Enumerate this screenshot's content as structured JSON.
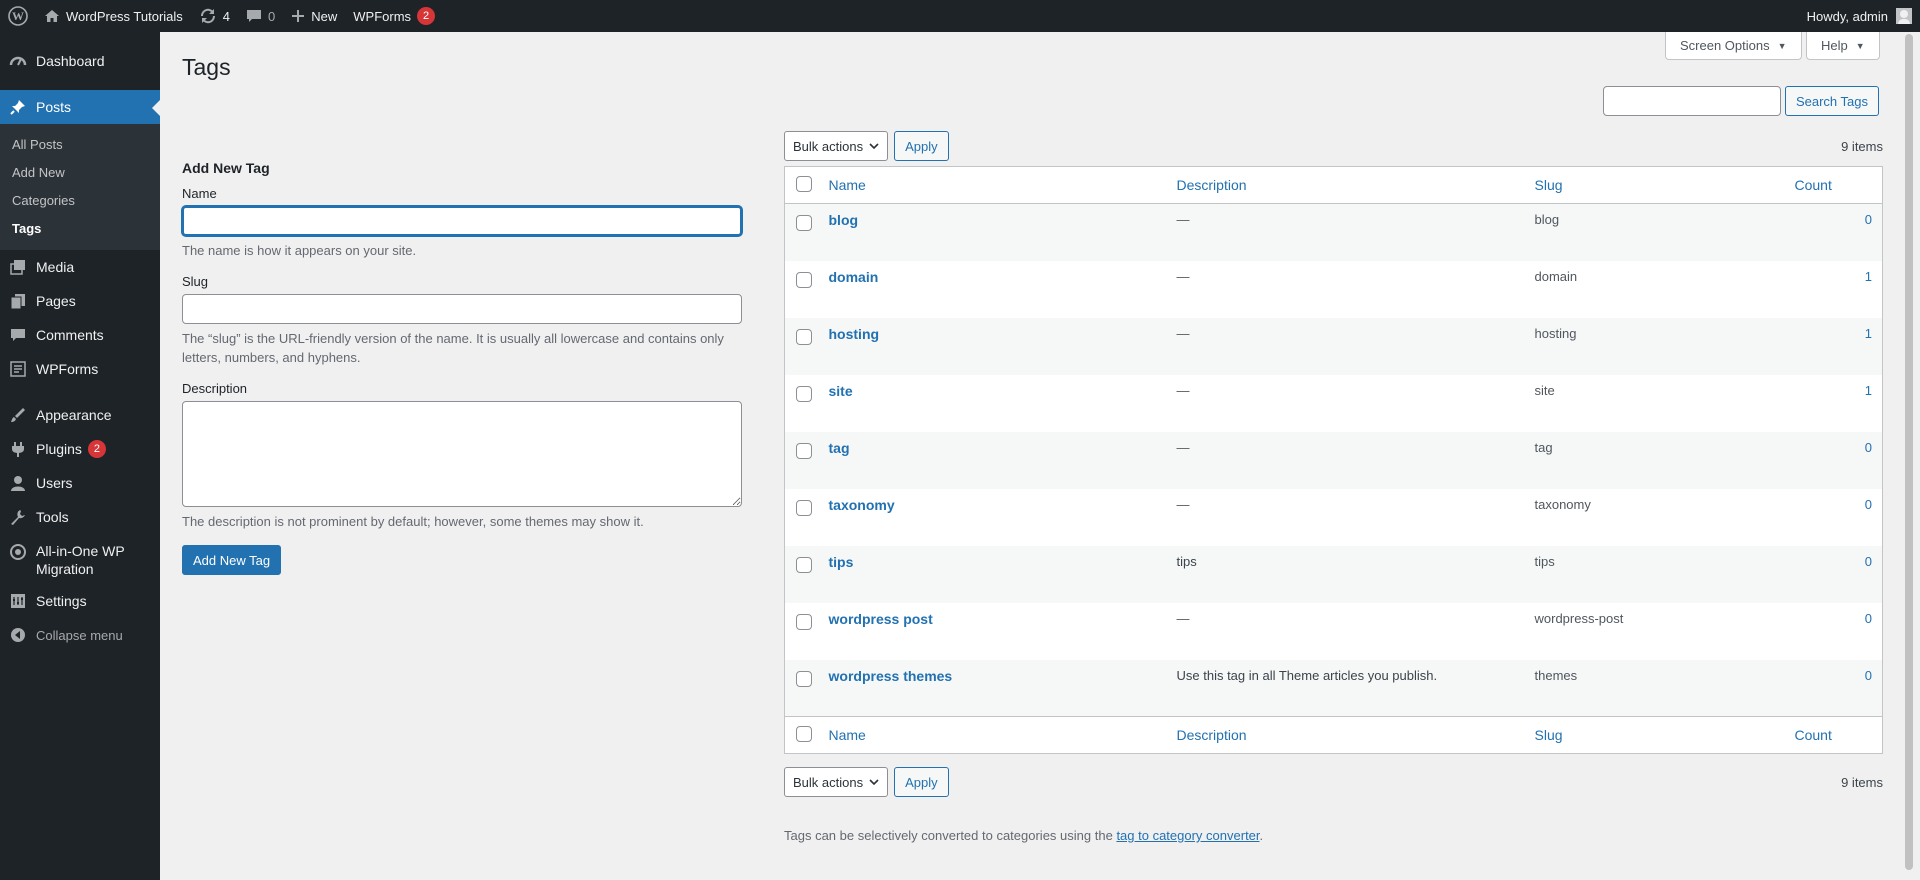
{
  "adminbar": {
    "site_name": "WordPress Tutorials",
    "updates_count": "4",
    "comments_count": "0",
    "new_label": "New",
    "wpforms_label": "WPForms",
    "wpforms_badge": "2",
    "howdy": "Howdy, admin"
  },
  "sidebar": {
    "dashboard": "Dashboard",
    "posts": "Posts",
    "posts_sub": [
      "All Posts",
      "Add New",
      "Categories",
      "Tags"
    ],
    "media": "Media",
    "pages": "Pages",
    "comments": "Comments",
    "wpforms": "WPForms",
    "appearance": "Appearance",
    "plugins": "Plugins",
    "plugins_badge": "2",
    "users": "Users",
    "tools": "Tools",
    "migration_line1": "All-in-One WP",
    "migration_line2": "Migration",
    "settings": "Settings",
    "collapse": "Collapse menu"
  },
  "header": {
    "title": "Tags",
    "screen_options": "Screen Options",
    "help": "Help",
    "search_button": "Search Tags",
    "search_value": ""
  },
  "form": {
    "heading": "Add New Tag",
    "name_label": "Name",
    "name_value": "",
    "name_help": "The name is how it appears on your site.",
    "slug_label": "Slug",
    "slug_value": "",
    "slug_help": "The “slug” is the URL-friendly version of the name. It is usually all lowercase and contains only letters, numbers, and hyphens.",
    "description_label": "Description",
    "description_value": "",
    "description_help": "The description is not prominent by default; however, some themes may show it.",
    "submit": "Add New Tag"
  },
  "table": {
    "bulk_actions": "Bulk actions",
    "apply": "Apply",
    "items_count": "9 items",
    "columns": {
      "name": "Name",
      "description": "Description",
      "slug": "Slug",
      "count": "Count"
    },
    "rows": [
      {
        "name": "blog",
        "description": "—",
        "slug": "blog",
        "count": "0"
      },
      {
        "name": "domain",
        "description": "—",
        "slug": "domain",
        "count": "1"
      },
      {
        "name": "hosting",
        "description": "—",
        "slug": "hosting",
        "count": "1"
      },
      {
        "name": "site",
        "description": "—",
        "slug": "site",
        "count": "1"
      },
      {
        "name": "tag",
        "description": "—",
        "slug": "tag",
        "count": "0"
      },
      {
        "name": "taxonomy",
        "description": "—",
        "slug": "taxonomy",
        "count": "0"
      },
      {
        "name": "tips",
        "description": "tips",
        "slug": "tips",
        "count": "0"
      },
      {
        "name": "wordpress post",
        "description": "—",
        "slug": "wordpress-post",
        "count": "0"
      },
      {
        "name": "wordpress themes",
        "description": "Use this tag in all Theme articles you publish.",
        "slug": "themes",
        "count": "0"
      }
    ]
  },
  "footer_note": {
    "text": "Tags can be selectively converted to categories using the",
    "link": "tag to category converter",
    "end": "."
  },
  "colors": {
    "adminbar_bg": "#1d2327",
    "sidebar_bg": "#1d2327",
    "accent": "#2271b1",
    "badge": "#d63638",
    "page_bg": "#f0f0f1"
  },
  "icons": [
    "wordpress-logo-icon",
    "home-icon",
    "updates-icon",
    "comments-icon",
    "plus-icon",
    "dashboard-icon",
    "pin-icon",
    "media-icon",
    "pages-icon",
    "comment-bubble-icon",
    "wpforms-icon",
    "appearance-icon",
    "plugins-icon",
    "users-icon",
    "tools-icon",
    "migration-icon",
    "settings-icon",
    "collapse-icon"
  ]
}
